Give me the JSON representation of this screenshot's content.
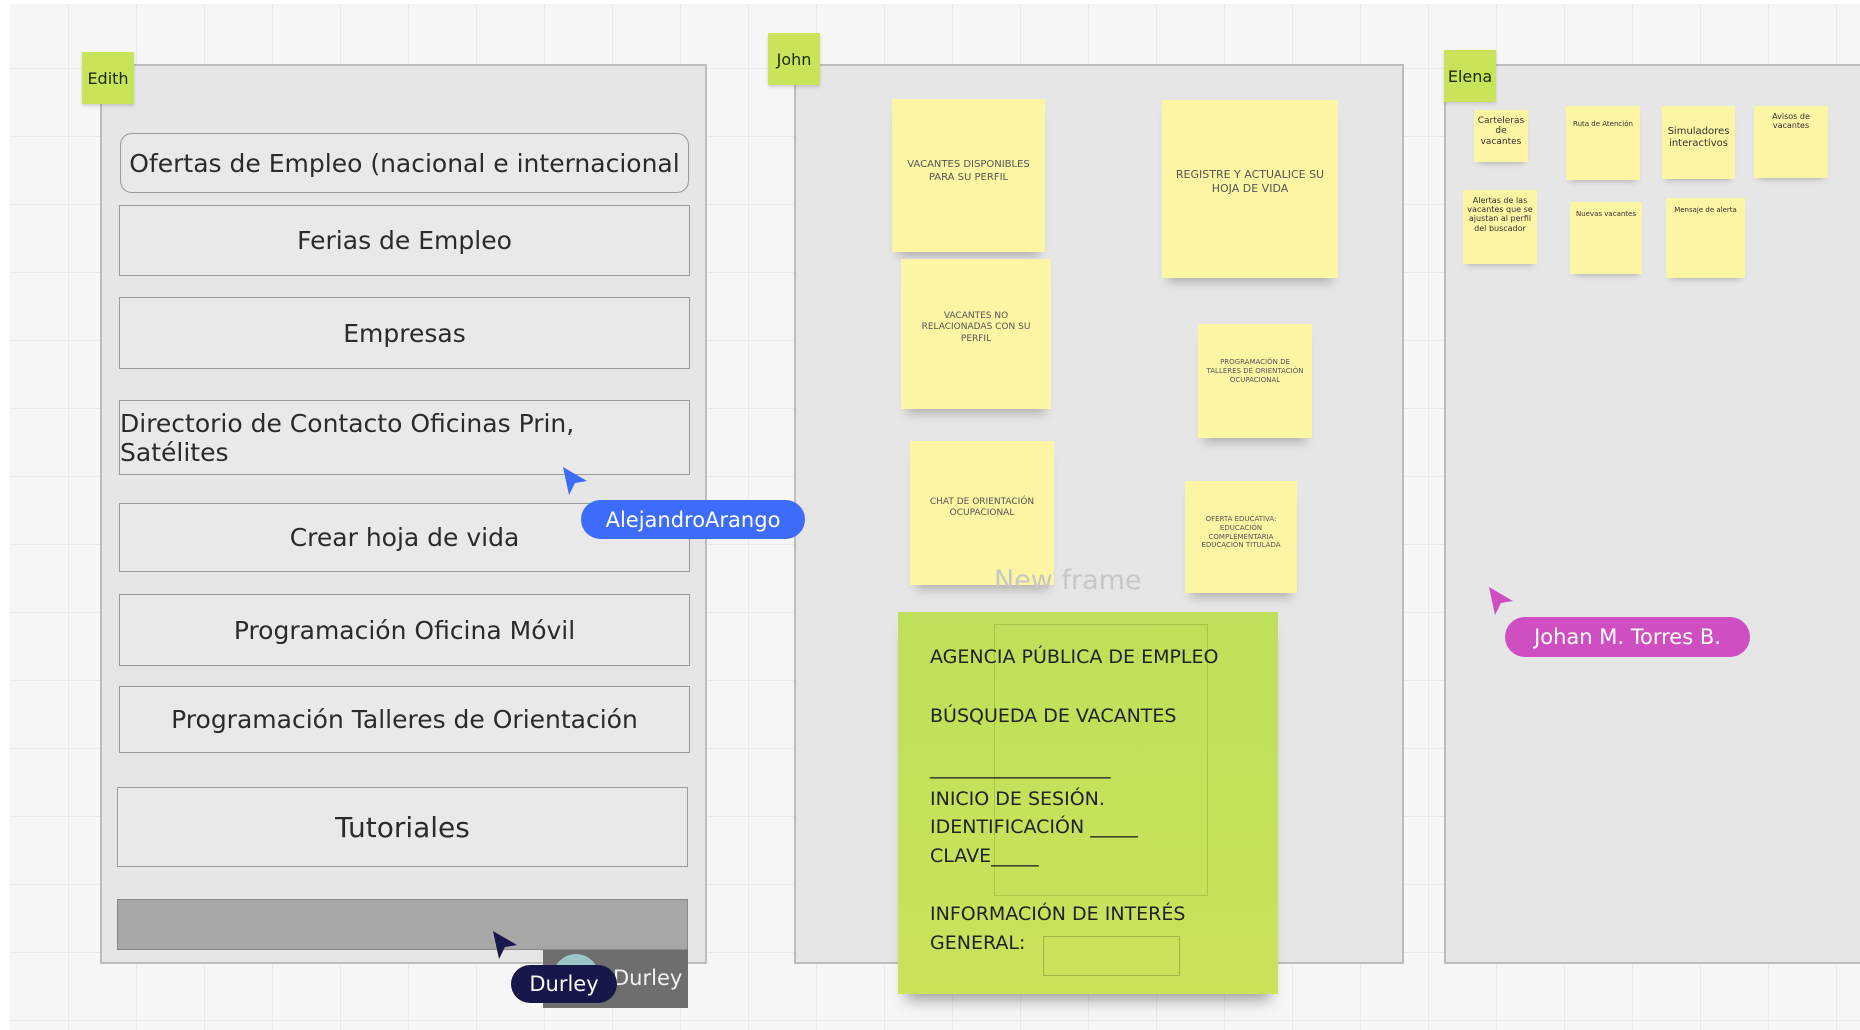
{
  "colors": {
    "frame_tag": "#c9e35b",
    "sticky": "#fbf5a4",
    "green_note": "#c9e35b",
    "alejandro": "#3d6bfa",
    "johan": "#cf4fc2",
    "durley": "#17174a"
  },
  "frames": {
    "edith": {
      "tag": "Edith"
    },
    "john": {
      "tag": "John",
      "caption": "New frame"
    },
    "elena": {
      "tag": "Elena"
    }
  },
  "edith_menu": [
    {
      "label": "Ofertas de Empleo (nacional e internacional"
    },
    {
      "label": "Ferias de Empleo"
    },
    {
      "label": "Empresas"
    },
    {
      "label": "Directorio de Contacto Oficinas Prin, Satélites"
    },
    {
      "label": "Crear hoja de vida"
    },
    {
      "label": "Programación Oficina Móvil"
    },
    {
      "label": "Programación Talleres de Orientación"
    },
    {
      "label": "Tutoriales"
    }
  ],
  "john_notes": [
    {
      "text": "VACANTES DISPONIBLES PARA SU PERFIL"
    },
    {
      "text": "REGISTRE Y ACTUALICE SU HOJA DE VIDA"
    },
    {
      "text": "VACANTES NO RELACIONADAS CON SU PERFIL"
    },
    {
      "text": "PROGRAMACIÓN DE TALLERES DE ORIENTACIÓN OCUPACIONAL"
    },
    {
      "text": "CHAT DE ORIENTACIÓN OCUPACIONAL"
    },
    {
      "text": "OFERTA EDUCATIVA: EDUCACIÓN COMPLEMENTARIA EDUCACIÓN TITULADA"
    }
  ],
  "green_note": {
    "line1": "AGENCIA PÚBLICA DE EMPLEO",
    "line2": "BÚSQUEDA DE VACANTES",
    "rule": "___________________",
    "line3": "INICIO DE SESIÓN.",
    "line4": "IDENTIFICACIÓN _____",
    "line5": "CLAVE_____",
    "line6": "INFORMACIÓN DE INTERÉS",
    "line7": "GENERAL:"
  },
  "elena_notes": [
    {
      "text": "Carteleras de vacantes"
    },
    {
      "text": "Ruta de Atención"
    },
    {
      "text": "Simuladores interactivos"
    },
    {
      "text": "Avisos de vacantes"
    },
    {
      "text": "Alertas de las vacantes que se ajustan al perfil del buscador"
    },
    {
      "text": "Nuevas vacantes"
    },
    {
      "text": "Mensaje de alerta"
    }
  ],
  "cursors": {
    "alejandro": {
      "name": "AlejandroArango"
    },
    "johan": {
      "name": "Johan M. Torres B."
    },
    "durley": {
      "name": "Durley",
      "avatar_name": "Durley"
    }
  }
}
